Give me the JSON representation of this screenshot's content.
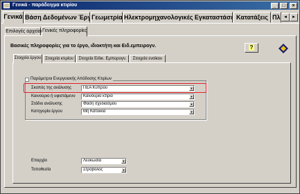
{
  "window": {
    "title": "Γενικά - παράδειγμα κτιρίου",
    "controls": [
      "_",
      "□",
      "×"
    ]
  },
  "main_tabs": [
    {
      "label": "Γενικά",
      "active": true
    },
    {
      "label": "Βάση Δεδομένων Έργου",
      "active": false
    },
    {
      "label": "Γεωμετρία",
      "active": false
    },
    {
      "label": "Ηλεκτρομηχανολογικές Εγκαταστάσεις",
      "active": false
    },
    {
      "label": "Κατατάξεις",
      "active": false
    },
    {
      "label": "Πληροφ",
      "active": false
    }
  ],
  "scroll_buttons": [
    "◄",
    "►"
  ],
  "sub_tabs": [
    {
      "label": "Επιλογές αρχείου",
      "active": false
    },
    {
      "label": "Γενικές πληροφορίες",
      "active": true
    }
  ],
  "heading": "Βασικές πληροφορίες για το έργο, ιδιοκτήτη και Ειδ.εμπειρογν.",
  "help_button": "?",
  "inner_tabs": [
    {
      "label": "Στοιχεία έργου",
      "active": true
    },
    {
      "label": "Στοιχεία κτιρίου",
      "active": false
    },
    {
      "label": "Στοιχεία Ειδικ. Εμπειρογν.",
      "active": false
    },
    {
      "label": "Στοιχεία ενοίκου",
      "active": false
    }
  ],
  "group_label": "Παράμετροι Ενεργειακής Απόδοσης Κτιρίων",
  "fields": [
    {
      "label": "Σκοπός της ανάλυσης",
      "value": "ΠΕΑ Κύπρου",
      "highlighted": true
    },
    {
      "label": "Καινούριο ή υφιστάμενο",
      "value": "Καινούριο κτίριο",
      "highlighted": false
    },
    {
      "label": "Στάδιο ανάλυσης",
      "value": "Φάση σχεδιασμού",
      "highlighted": false
    },
    {
      "label": "Κατηγορία έργου",
      "value": "Μη Κατοικία",
      "highlighted": false
    }
  ],
  "location_fields": [
    {
      "label": "Επαρχία",
      "value": "Λευκωσία"
    },
    {
      "label": "Τοποθεσία",
      "value": "Στρόβολος"
    }
  ],
  "colors": {
    "highlight": "#e0202a",
    "title_bar": "#0a246a"
  }
}
